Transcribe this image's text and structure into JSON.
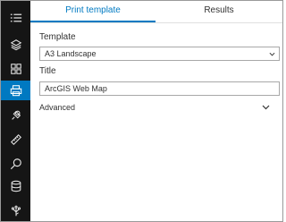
{
  "colors": {
    "accent": "#007ac2",
    "rail_bg": "#151515",
    "rail_active": "#0079c1"
  },
  "rail": {
    "items": [
      {
        "icon": "list-icon",
        "active": false
      },
      {
        "icon": "layers-icon",
        "active": false
      },
      {
        "icon": "basemap-gallery-icon",
        "active": false
      },
      {
        "icon": "print-icon",
        "active": true
      },
      {
        "icon": "bookmark-icon",
        "active": false
      },
      {
        "icon": "measure-icon",
        "active": false
      },
      {
        "icon": "search-icon",
        "active": false
      },
      {
        "icon": "database-icon",
        "active": false
      },
      {
        "icon": "share-icon",
        "active": false
      }
    ]
  },
  "tabs": [
    {
      "label": "Print template",
      "active": true
    },
    {
      "label": "Results",
      "active": false
    }
  ],
  "form": {
    "template_label": "Template",
    "template_value": "A3 Landscape",
    "title_label": "Title",
    "title_value": "ArcGIS Web Map",
    "advanced_label": "Advanced"
  }
}
